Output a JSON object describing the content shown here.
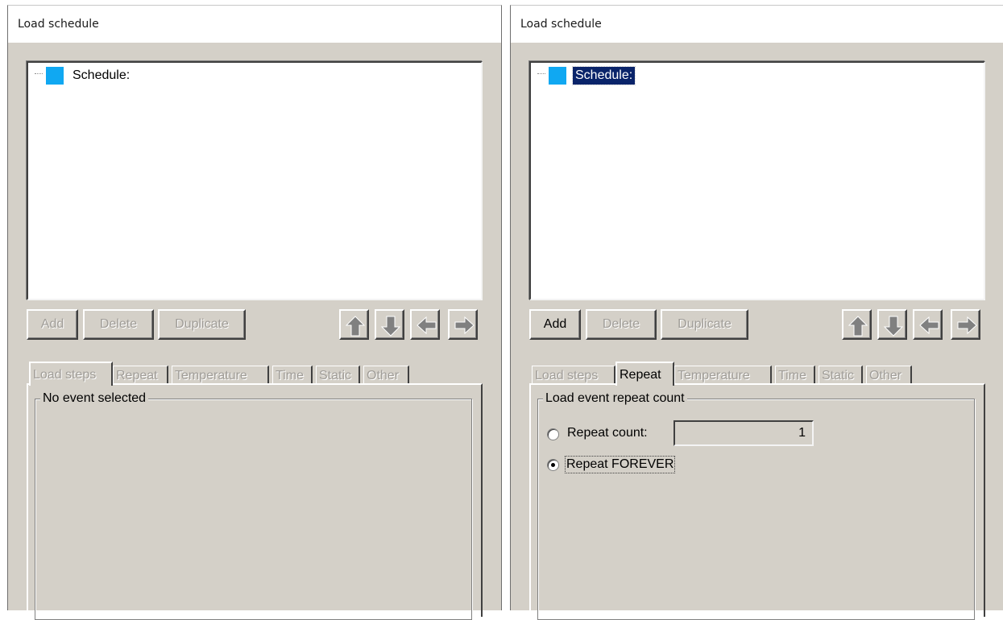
{
  "left_window": {
    "title": "Load schedule",
    "tree": {
      "root_label": "Schedule:",
      "root_selected": false
    },
    "buttons": {
      "add": "Add",
      "delete": "Delete",
      "duplicate": "Duplicate"
    },
    "arrows": [
      "up-arrow-icon",
      "down-arrow-icon",
      "left-arrow-icon",
      "right-arrow-icon"
    ],
    "tabs": [
      "Load steps",
      "Repeat",
      "Temperature",
      "Time",
      "Static",
      "Other"
    ],
    "active_tab": "Load steps",
    "group_title": "No event selected"
  },
  "right_window": {
    "title": "Load schedule",
    "tree": {
      "root_label": "Schedule:",
      "root_selected": true
    },
    "buttons": {
      "add": "Add",
      "delete": "Delete",
      "duplicate": "Duplicate"
    },
    "arrows": [
      "up-arrow-icon",
      "down-arrow-icon",
      "left-arrow-icon",
      "right-arrow-icon"
    ],
    "tabs": [
      "Load steps",
      "Repeat",
      "Temperature",
      "Time",
      "Static",
      "Other"
    ],
    "active_tab": "Repeat",
    "group_title": "Load event repeat count",
    "repeat_count_label": "Repeat count:",
    "repeat_count_value": "1",
    "repeat_forever_label": "Repeat FOREVER",
    "selected_option": "Repeat FOREVER"
  },
  "colors": {
    "window_bg": "#d4d0c8",
    "node_icon": "#10a8f2",
    "selection": "#0a246a",
    "disabled_text": "#a09d98"
  }
}
